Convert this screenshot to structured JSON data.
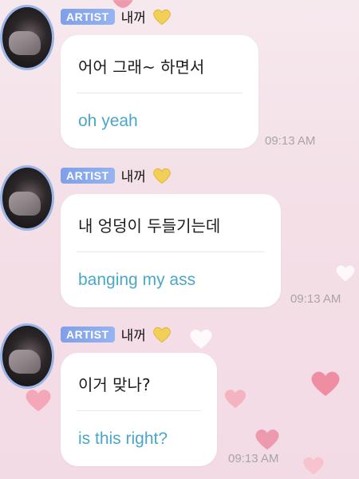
{
  "colors": {
    "badge": "#8aa9ec",
    "translation_text": "#4aa7c8",
    "heart": "#f0a3b4",
    "gold_heart": "#f2cf57",
    "avatar_ring": "#9bb6e6"
  },
  "messages": [
    {
      "badge": "ARTIST",
      "nickname": "내꺼",
      "nickname_icon": "gold-heart-icon",
      "original": "어어 그래~ 하면서",
      "translation": "oh yeah",
      "time": "09:13 AM"
    },
    {
      "badge": "ARTIST",
      "nickname": "내꺼",
      "nickname_icon": "gold-heart-icon",
      "original": "내 엉덩이 두들기는데",
      "translation": "banging my ass",
      "time": "09:13 AM"
    },
    {
      "badge": "ARTIST",
      "nickname": "내꺼",
      "nickname_icon": "gold-heart-icon",
      "original": "이거 맞나?",
      "translation": "is this right?",
      "time": "09:13 AM"
    }
  ]
}
